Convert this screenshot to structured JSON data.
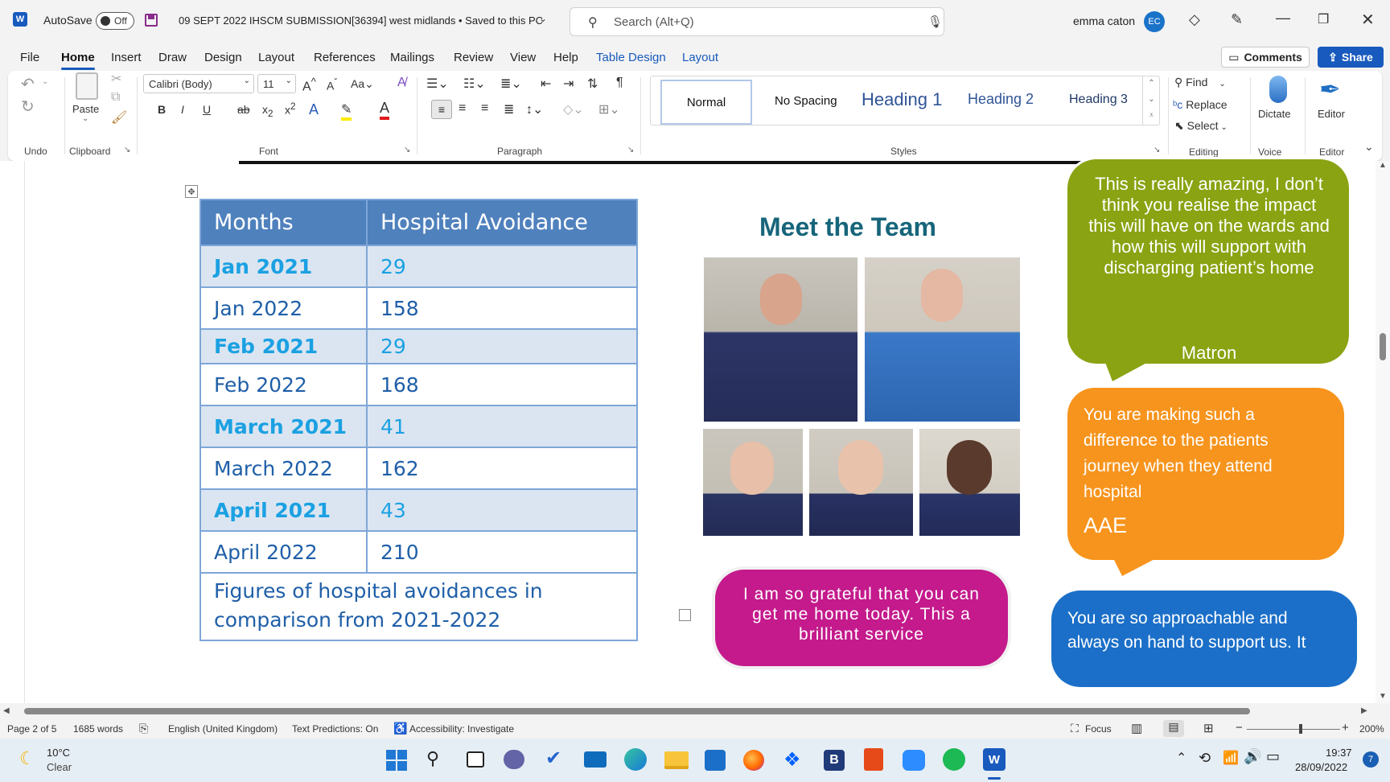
{
  "titlebar": {
    "autosave_label": "AutoSave",
    "autosave_state": "Off",
    "doc_title": "09 SEPT 2022 IHSCM SUBMISSION[36394] west midlands • Saved to this PC",
    "search_placeholder": "Search (Alt+Q)",
    "user_name": "emma caton",
    "user_initials": "EC"
  },
  "menu": {
    "tabs": [
      "File",
      "Home",
      "Insert",
      "Draw",
      "Design",
      "Layout",
      "References",
      "Mailings",
      "Review",
      "View",
      "Help",
      "Table Design",
      "Layout"
    ],
    "comments_label": "Comments",
    "share_label": "Share"
  },
  "ribbon": {
    "groups": {
      "undo": "Undo",
      "clipboard": "Clipboard",
      "font": "Font",
      "paragraph": "Paragraph",
      "styles": "Styles",
      "editing": "Editing",
      "voice": "Voice",
      "editor": "Editor"
    },
    "paste_label": "Paste",
    "font_name": "Calibri (Body)",
    "font_size": "11",
    "styles": [
      "Normal",
      "No Spacing",
      "Heading 1",
      "Heading 2",
      "Heading 3"
    ],
    "find_label": "Find",
    "replace_label": "Replace",
    "select_label": "Select",
    "dictate_label": "Dictate",
    "editor_label": "Editor"
  },
  "document": {
    "table": {
      "headers": [
        "Months",
        "Hospital Avoidance"
      ],
      "rows": [
        {
          "month": "Jan 2021",
          "value": "29",
          "highlight": true
        },
        {
          "month": "Jan 2022",
          "value": "158",
          "highlight": false
        },
        {
          "month": "Feb 2021",
          "value": "29",
          "highlight": true
        },
        {
          "month": "Feb 2022",
          "value": "168",
          "highlight": false
        },
        {
          "month": "March 2021",
          "value": "41",
          "highlight": true
        },
        {
          "month": "March 2022",
          "value": "162",
          "highlight": false
        },
        {
          "month": "April 2021",
          "value": "43",
          "highlight": true
        },
        {
          "month": "April 2022",
          "value": "210",
          "highlight": false
        }
      ],
      "caption": "Figures of hospital avoidances in comparison from 2021-2022"
    },
    "meet_title": "Meet the Team",
    "bubbles": {
      "matron_quote": "This is really amazing, I don’t think you realise the impact this will have on the wards and how this will support with discharging patient’s home",
      "matron_author": "Matron",
      "aae_quote": "You are making such a difference to the patients journey when they attend hospital",
      "aae_author": "AAE",
      "grateful_quote": "I am so grateful that you can get me home today. This a brilliant service",
      "approachable_quote": "You are so approachable and always on hand to support us. It"
    }
  },
  "statusbar": {
    "page": "Page 2 of 5",
    "words": "1685 words",
    "language": "English (United Kingdom)",
    "predictions": "Text Predictions: On",
    "accessibility": "Accessibility: Investigate",
    "focus": "Focus",
    "zoom": "200%"
  },
  "taskbar": {
    "temp": "10°C",
    "weather": "Clear",
    "time": "19:37",
    "date": "28/09/2022",
    "badge": "7"
  },
  "colors": {
    "table_header": "#4f81bd",
    "table_light": "#dbe5f1",
    "accent_cyan": "#1ba1e2",
    "text_blue": "#1f5fa8",
    "heading_teal": "#17657a",
    "bubble_green": "#8aa312",
    "bubble_orange": "#f7941d",
    "bubble_magenta": "#c41a8c",
    "bubble_blue": "#1b6fc8",
    "word_blue": "#185abd"
  }
}
